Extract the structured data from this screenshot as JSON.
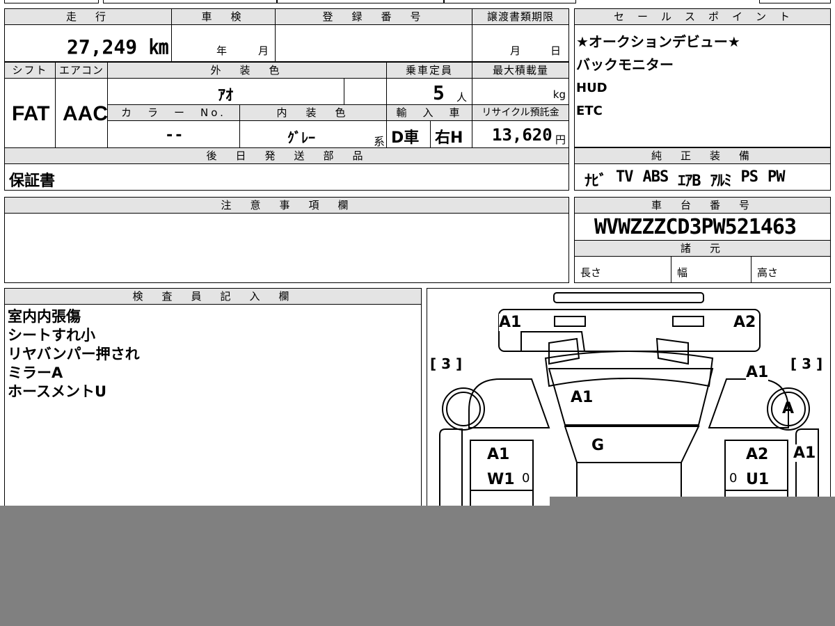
{
  "mileage": {
    "header": "走　行",
    "value": "27,249 ㎞"
  },
  "shaken": {
    "header": "車　検",
    "year_unit": "年",
    "month_unit": "月"
  },
  "registration": {
    "header": "登　録　番　号",
    "value": ""
  },
  "transfer_deadline": {
    "header": "譲渡書類期限",
    "month_unit": "月",
    "day_unit": "日"
  },
  "shift": {
    "header": "シフト",
    "value": "FAT"
  },
  "aircon": {
    "header": "エアコン",
    "value": "AAC"
  },
  "exterior_color": {
    "header": "外　装　色",
    "value": "ｱｵ"
  },
  "capacity": {
    "header": "乗車定員",
    "value": "5",
    "unit": "人"
  },
  "max_load": {
    "header": "最大積載量",
    "unit": "kg"
  },
  "color_no": {
    "header": "カ　ラ　ー　No.",
    "value": "--"
  },
  "interior_color": {
    "header": "内　装　色",
    "value": "ｸﾞﾚｰ",
    "suffix": "系"
  },
  "import": {
    "header": "輸　入　車",
    "drive": "D車",
    "handle": "右H"
  },
  "recycle": {
    "header": "リサイクル預託金",
    "value": "13,620",
    "unit": "円"
  },
  "later_parts": {
    "header": "後　日　発　送　部　品",
    "value": "保証書"
  },
  "notes": {
    "header": "注　意　事　項　欄"
  },
  "sales_points": {
    "header": "セ　ー　ル　ス　ポ　イ　ン　ト",
    "lines": [
      "★オークションデビュー★",
      "バックモニター",
      "HUD",
      "ETC"
    ]
  },
  "equipment": {
    "header": "純　正　装　備",
    "items": [
      "ﾅﾋﾞ",
      "TV",
      "ABS",
      "ｴｱB",
      "ｱﾙﾐ",
      "PS",
      "PW"
    ]
  },
  "chassis": {
    "header": "車　台　番　号",
    "value": "WVWZZZCD3PW521463"
  },
  "specs": {
    "header": "諸　元",
    "length": "長さ",
    "width": "幅",
    "height": "高さ"
  },
  "inspector": {
    "header": "検　査　員　記　入　欄",
    "lines": [
      "室内内張傷",
      "シートすれ小",
      "リヤバンパー押され",
      "ミラーA",
      "ホースメントU"
    ]
  },
  "diagram": {
    "left_bracket": "[ 3 ]",
    "right_bracket": "[ 3 ]",
    "marks": {
      "front_left": "A1",
      "front_right": "A2",
      "right_fender": "A1",
      "right_mirror": "A",
      "hood": "A1",
      "windshield": "G",
      "left_front_door": "A1",
      "left_front_door_2": "W1",
      "right_front_door": "A2",
      "right_front_door_2": "U1",
      "right_pillar": "A1",
      "zero_left": "0",
      "zero_right": "0"
    }
  },
  "colors": {
    "header_bg": "#e4e4e4",
    "border": "#000000",
    "overlay": "#808080"
  }
}
